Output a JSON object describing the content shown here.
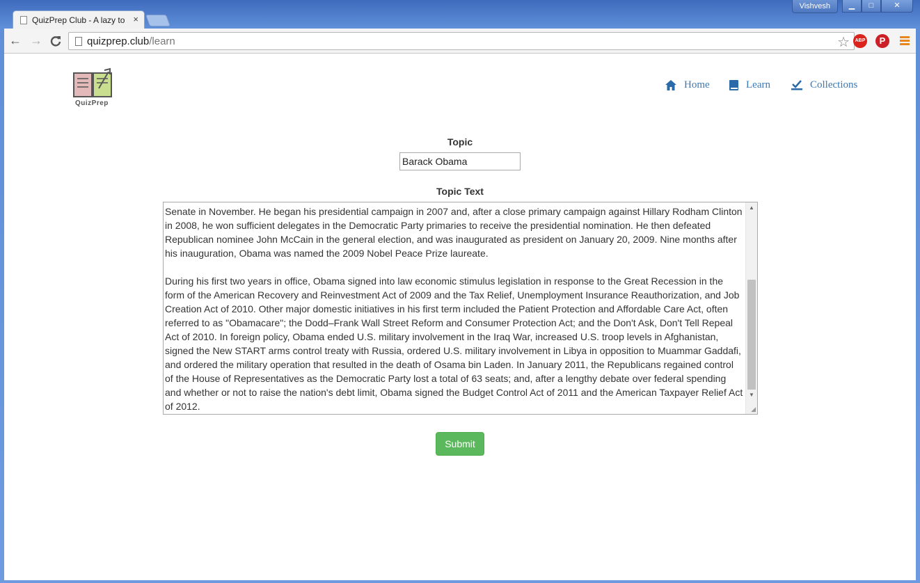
{
  "window": {
    "user_name": "Vishvesh",
    "controls": {
      "minimize": "▁",
      "maximize": "□",
      "close": "✕"
    }
  },
  "tab": {
    "title": "QuizPrep Club - A lazy to",
    "close": "×"
  },
  "toolbar": {
    "back": "←",
    "forward": "→",
    "reload": "C",
    "url_domain": "quizprep.club",
    "url_path": "/learn",
    "bookmark_star": "☆",
    "ext_adblock": "ABP",
    "ext_pinterest": "P"
  },
  "site": {
    "logo_text": "QuizPrep",
    "nav": [
      {
        "label": "Home",
        "icon": "home-icon"
      },
      {
        "label": "Learn",
        "icon": "book-icon"
      },
      {
        "label": "Collections",
        "icon": "check-icon"
      }
    ]
  },
  "form": {
    "topic_label": "Topic",
    "topic_value": "Barack Obama",
    "topic_text_label": "Topic Text",
    "topic_text_paragraphs": [
      "Senate in November. He began his presidential campaign in 2007 and, after a close primary campaign against Hillary Rodham Clinton in 2008, he won sufficient delegates in the Democratic Party primaries to receive the presidential nomination. He then defeated Republican nominee John McCain in the general election, and was inaugurated as president on January 20, 2009. Nine months after his inauguration, Obama was named the 2009 Nobel Peace Prize laureate.",
      "During his first two years in office, Obama signed into law economic stimulus legislation in response to the Great Recession in the form of the American Recovery and Reinvestment Act of 2009 and the Tax Relief, Unemployment Insurance Reauthorization, and Job Creation Act of 2010. Other major domestic initiatives in his first term included the Patient Protection and Affordable Care Act, often referred to as \"Obamacare\"; the Dodd–Frank Wall Street Reform and Consumer Protection Act; and the Don't Ask, Don't Tell Repeal Act of 2010. In foreign policy, Obama ended U.S. military involvement in the Iraq War, increased U.S. troop levels in Afghanistan, signed the New START arms control treaty with Russia, ordered U.S. military involvement in Libya in opposition to Muammar Gaddafi, and ordered the military operation that resulted in the death of Osama bin Laden. In January 2011, the Republicans regained control of the House of Representatives as the Democratic Party lost a total of 63 seats; and, after a lengthy debate over federal spending and whether or not to raise the nation's debt limit, Obama signed the Budget Control Act of 2011 and the American Taxpayer Relief Act of 2012."
    ],
    "submit_label": "Submit"
  },
  "colors": {
    "submit": "#5cb85c",
    "nav_link": "#3b78b4",
    "frame": "#5f8fd8"
  }
}
